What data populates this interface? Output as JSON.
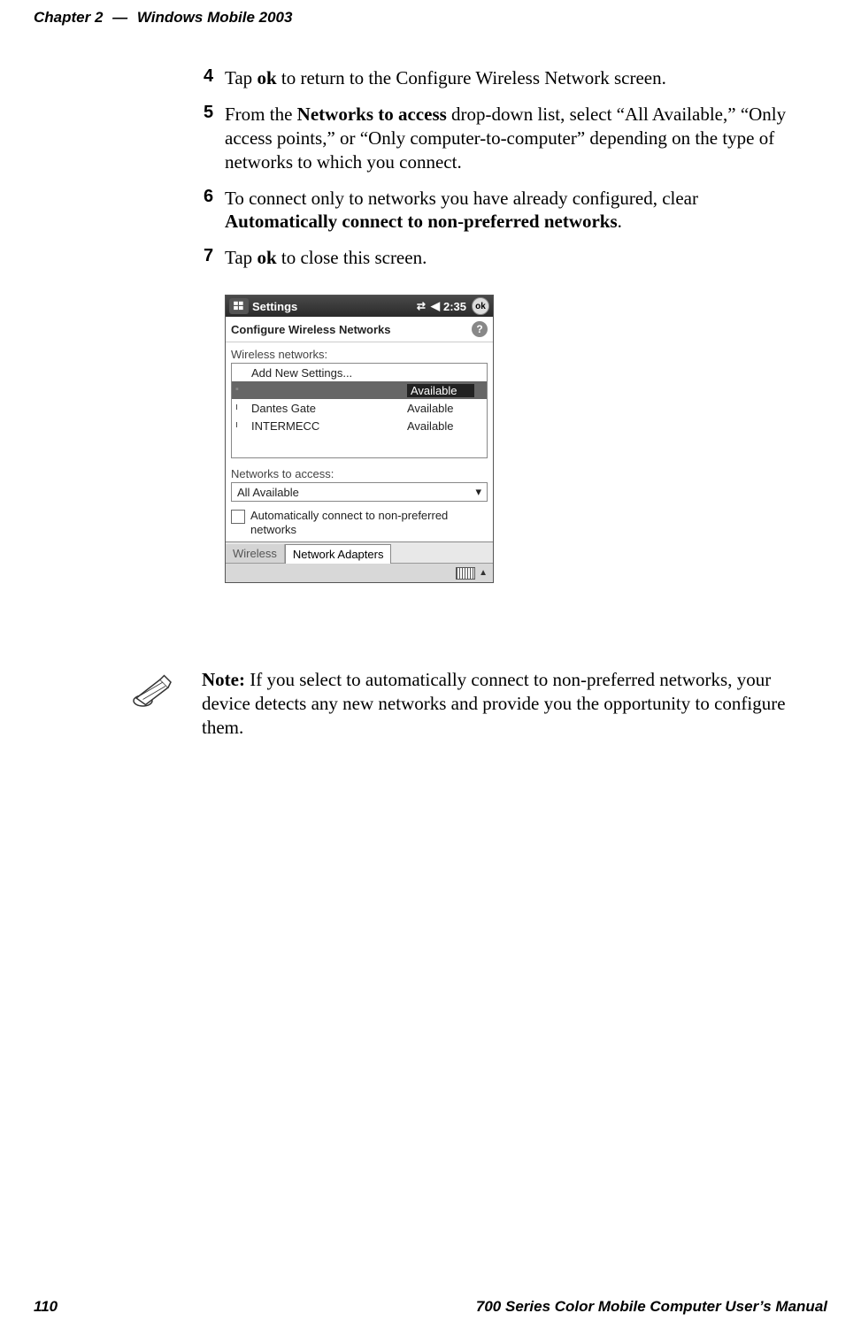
{
  "header": {
    "chapter": "Chapter 2",
    "dash": "—",
    "title": "Windows Mobile 2003"
  },
  "steps": {
    "s4": {
      "num": "4",
      "p1": "Tap ",
      "b1": "ok",
      "p2": " to return to the Configure Wireless Network screen."
    },
    "s5": {
      "num": "5",
      "p1": "From the ",
      "b1": "Networks to access",
      "p2": " drop-down list, select “All Available,” “Only access points,” or “Only computer-to-computer” depending on the type of networks to which you connect."
    },
    "s6": {
      "num": "6",
      "p1": "To connect only to networks you have already configured, clear ",
      "b1": "Automatically connect to non-preferred networks",
      "p2": "."
    },
    "s7": {
      "num": "7",
      "p1": "Tap ",
      "b1": "ok",
      "p2": " to close this screen."
    }
  },
  "screenshot": {
    "titlebar": {
      "title": "Settings",
      "time": "2:35",
      "ok": "ok"
    },
    "heading": "Configure Wireless Networks",
    "list_label": "Wireless networks:",
    "rows": {
      "r0": {
        "name": "Add New Settings...",
        "status": ""
      },
      "r1": {
        "name": "",
        "status": "Available"
      },
      "r2": {
        "name": "Dantes Gate",
        "status": "Available"
      },
      "r3": {
        "name": "INTERMECC",
        "status": "Available"
      }
    },
    "access_label": "Networks to access:",
    "access_value": "All Available",
    "checkbox_label": "Automatically connect to non-preferred networks",
    "tabs": {
      "t0": "Wireless",
      "t1": "Network Adapters"
    }
  },
  "note": {
    "label": "Note:",
    "text": " If you select to automatically connect to non-preferred networks, your device detects any new networks and provide you the opportunity to configure them."
  },
  "footer": {
    "page": "110",
    "manual": "700 Series Color Mobile Computer User’s Manual"
  }
}
